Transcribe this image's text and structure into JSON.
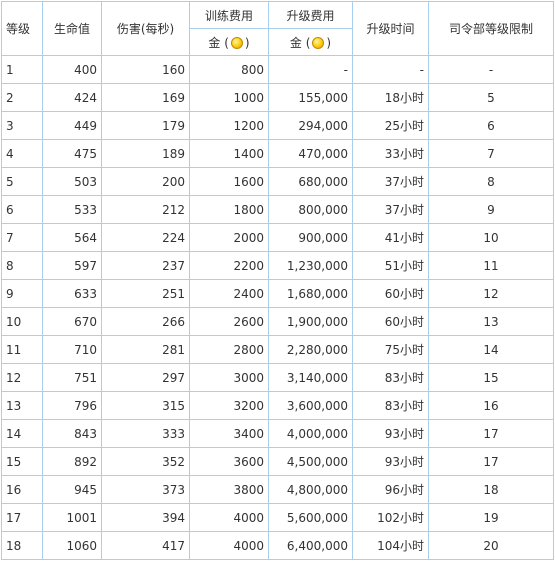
{
  "headers": {
    "level": "等级",
    "hp": "生命值",
    "damage": "伤害(每秒)",
    "train_cost": "训练费用",
    "train_cost_unit": "金",
    "upgrade_cost": "升级费用",
    "upgrade_cost_unit": "金",
    "upgrade_time": "升级时间",
    "hq_level": "司令部等级限制",
    "paren_open": "(",
    "paren_close": ")",
    "coin_icon": "gold-coin-icon"
  },
  "rows": [
    {
      "level": "1",
      "hp": "400",
      "damage": "160",
      "train": "800",
      "upgrade": "-",
      "time": "-",
      "hq": "-"
    },
    {
      "level": "2",
      "hp": "424",
      "damage": "169",
      "train": "1000",
      "upgrade": "155,000",
      "time": "18小时",
      "hq": "5"
    },
    {
      "level": "3",
      "hp": "449",
      "damage": "179",
      "train": "1200",
      "upgrade": "294,000",
      "time": "25小时",
      "hq": "6"
    },
    {
      "level": "4",
      "hp": "475",
      "damage": "189",
      "train": "1400",
      "upgrade": "470,000",
      "time": "33小时",
      "hq": "7"
    },
    {
      "level": "5",
      "hp": "503",
      "damage": "200",
      "train": "1600",
      "upgrade": "680,000",
      "time": "37小时",
      "hq": "8"
    },
    {
      "level": "6",
      "hp": "533",
      "damage": "212",
      "train": "1800",
      "upgrade": "800,000",
      "time": "37小时",
      "hq": "9"
    },
    {
      "level": "7",
      "hp": "564",
      "damage": "224",
      "train": "2000",
      "upgrade": "900,000",
      "time": "41小时",
      "hq": "10"
    },
    {
      "level": "8",
      "hp": "597",
      "damage": "237",
      "train": "2200",
      "upgrade": "1,230,000",
      "time": "51小时",
      "hq": "11"
    },
    {
      "level": "9",
      "hp": "633",
      "damage": "251",
      "train": "2400",
      "upgrade": "1,680,000",
      "time": "60小时",
      "hq": "12"
    },
    {
      "level": "10",
      "hp": "670",
      "damage": "266",
      "train": "2600",
      "upgrade": "1,900,000",
      "time": "60小时",
      "hq": "13"
    },
    {
      "level": "11",
      "hp": "710",
      "damage": "281",
      "train": "2800",
      "upgrade": "2,280,000",
      "time": "75小时",
      "hq": "14"
    },
    {
      "level": "12",
      "hp": "751",
      "damage": "297",
      "train": "3000",
      "upgrade": "3,140,000",
      "time": "83小时",
      "hq": "15"
    },
    {
      "level": "13",
      "hp": "796",
      "damage": "315",
      "train": "3200",
      "upgrade": "3,600,000",
      "time": "83小时",
      "hq": "16"
    },
    {
      "level": "14",
      "hp": "843",
      "damage": "333",
      "train": "3400",
      "upgrade": "4,000,000",
      "time": "93小时",
      "hq": "17"
    },
    {
      "level": "15",
      "hp": "892",
      "damage": "352",
      "train": "3600",
      "upgrade": "4,500,000",
      "time": "93小时",
      "hq": "17"
    },
    {
      "level": "16",
      "hp": "945",
      "damage": "373",
      "train": "3800",
      "upgrade": "4,800,000",
      "time": "96小时",
      "hq": "18"
    },
    {
      "level": "17",
      "hp": "1001",
      "damage": "394",
      "train": "4000",
      "upgrade": "5,600,000",
      "time": "102小时",
      "hq": "19"
    },
    {
      "level": "18",
      "hp": "1060",
      "damage": "417",
      "train": "4000",
      "upgrade": "6,400,000",
      "time": "104小时",
      "hq": "20"
    }
  ]
}
